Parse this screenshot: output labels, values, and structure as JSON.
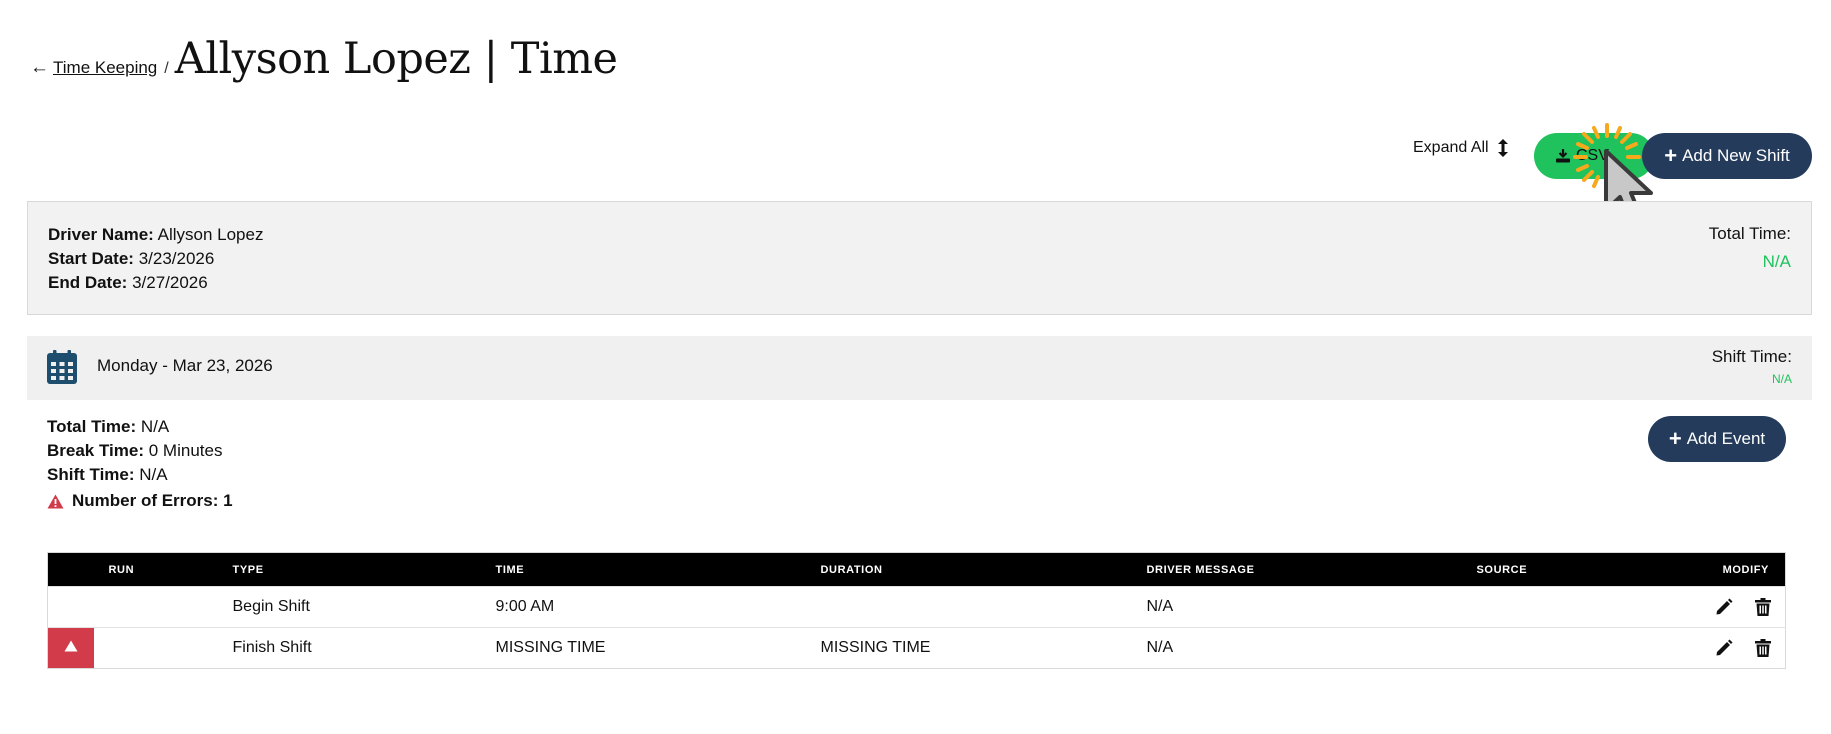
{
  "header": {
    "back_arrow": "←",
    "breadcrumb_link": "Time Keeping",
    "separator": "/",
    "title": "Allyson Lopez | Time"
  },
  "toolbar": {
    "expand_all_label": "Expand All",
    "csv_label": "CSV",
    "add_shift_label": "Add New Shift",
    "add_shift_plus": "+"
  },
  "summary": {
    "driver_name_label": "Driver Name:",
    "driver_name": "Allyson Lopez",
    "start_date_label": "Start Date:",
    "start_date": "3/23/2026",
    "end_date_label": "End Date:",
    "end_date": "3/27/2026",
    "total_time_label": "Total Time:",
    "total_time_value": "N/A"
  },
  "day": {
    "label": "Monday - Mar 23, 2026",
    "shift_time_label": "Shift Time:",
    "shift_time_value": "N/A",
    "total_time_label": "Total Time:",
    "total_time": "N/A",
    "break_time_label": "Break Time:",
    "break_time": "0 Minutes",
    "shift_time_detail_label": "Shift Time:",
    "shift_time_detail": "N/A",
    "errors_label": "Number of Errors: 1",
    "add_event_label": "Add Event",
    "add_event_plus": "+"
  },
  "table": {
    "headers": {
      "run": "RUN",
      "type": "TYPE",
      "time": "TIME",
      "duration": "DURATION",
      "driver_message": "DRIVER MESSAGE",
      "source": "SOURCE",
      "modify": "MODIFY"
    },
    "rows": [
      {
        "run": "",
        "type": "Begin Shift",
        "time": "9:00 AM",
        "duration": "",
        "driver_message": "N/A",
        "source": ""
      },
      {
        "run": "",
        "type": "Finish Shift",
        "time": "MISSING TIME",
        "duration": "MISSING TIME",
        "driver_message": "N/A",
        "source": ""
      }
    ]
  },
  "colors": {
    "primary_navy": "#243b5c",
    "csv_green": "#1fc25d",
    "na_green": "#1fc25d",
    "error_red": "#d13b4a",
    "panel_grey": "#f2f2f2",
    "calendar_blue": "#1d4e6e"
  },
  "icons": {
    "expand": "up-down-arrow-icon",
    "csv": "download-icon",
    "calendar": "calendar-icon",
    "error": "warning-triangle-icon",
    "edit": "pencil-icon",
    "delete": "trash-icon"
  }
}
